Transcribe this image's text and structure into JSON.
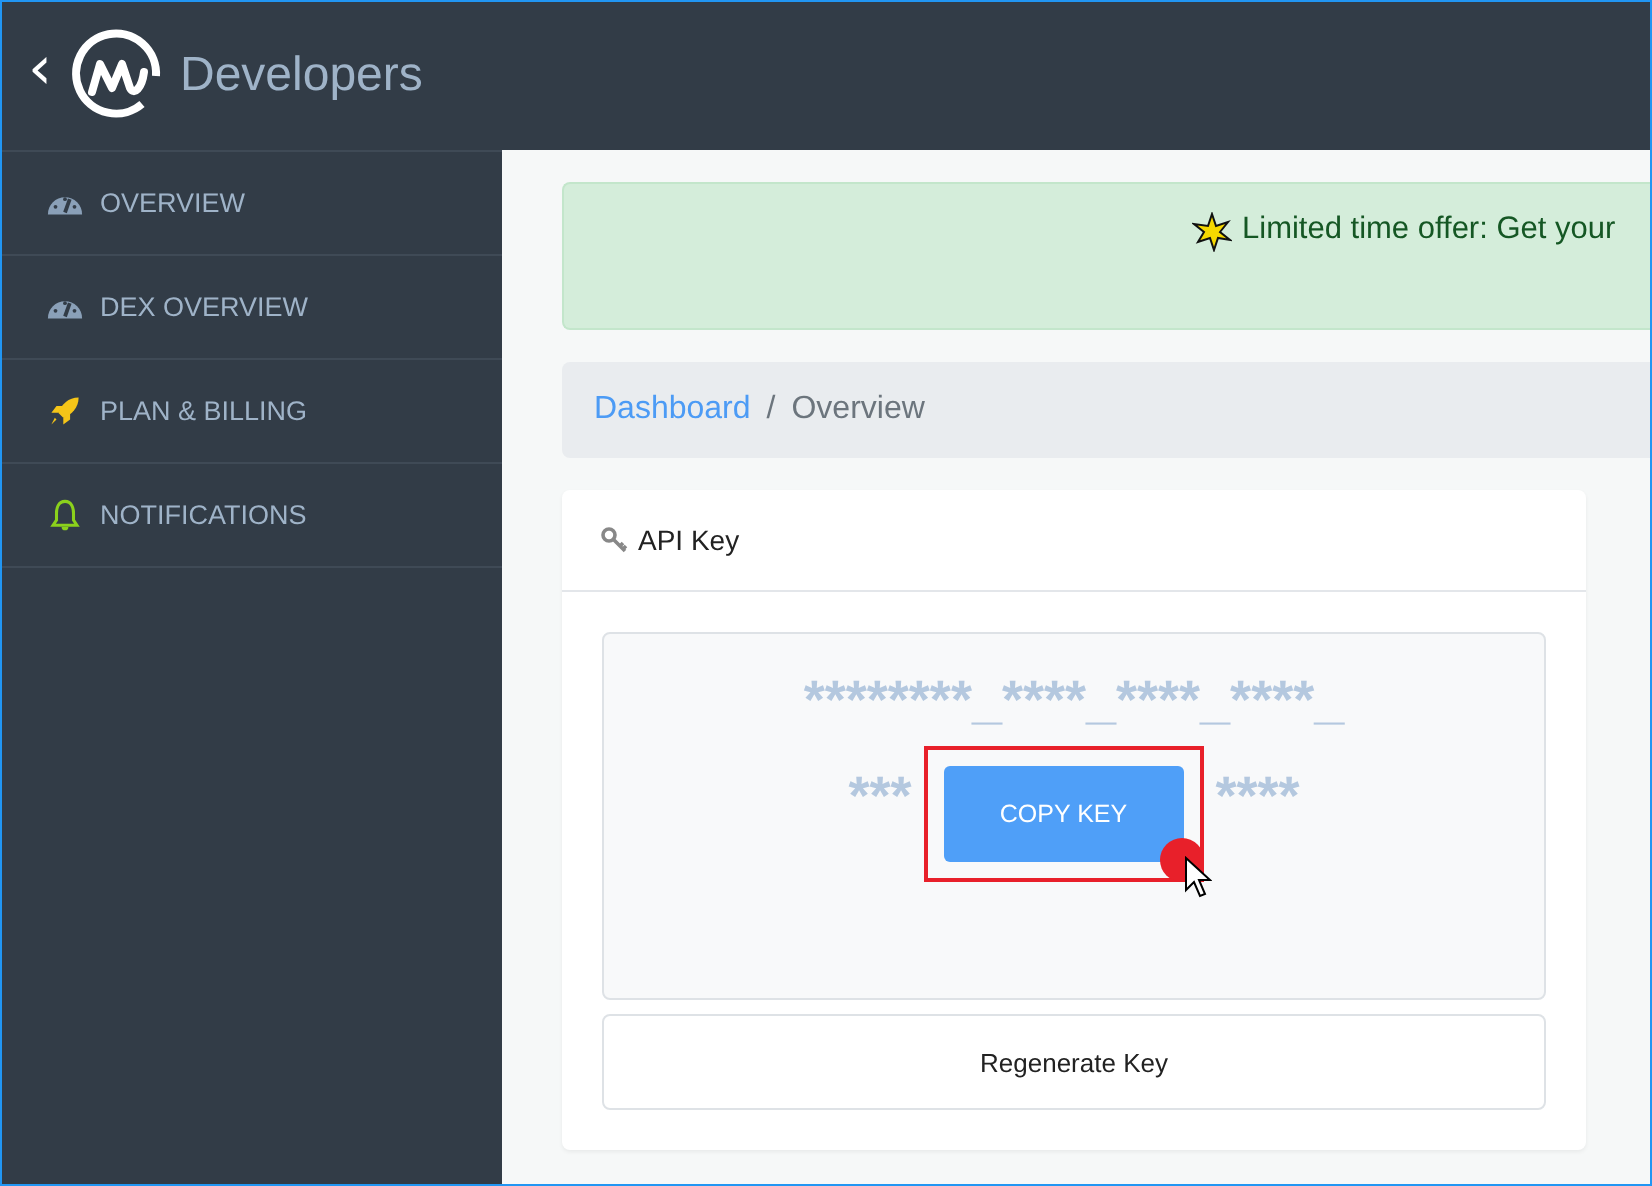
{
  "header": {
    "back": "‹",
    "title": "Developers"
  },
  "sidebar": {
    "items": [
      {
        "label": "OVERVIEW",
        "kind": "gauge",
        "selected": false
      },
      {
        "label": "DEX OVERVIEW",
        "kind": "gauge",
        "selected": false
      },
      {
        "label": "PLAN & BILLING",
        "kind": "rocket",
        "selected": false
      },
      {
        "label": "NOTIFICATIONS",
        "kind": "bell",
        "selected": false
      }
    ]
  },
  "banner": {
    "text": "Limited time offer: Get your"
  },
  "breadcrumb": [
    {
      "label": "Dashboard",
      "kind": "link"
    },
    {
      "label": "/",
      "kind": "separator"
    },
    {
      "label": "Overview",
      "kind": "current"
    }
  ],
  "api_card": {
    "title": "API Key",
    "key_line": "********_****_****_****_",
    "key_left": "***",
    "key_right": "****",
    "copy_button": "COPY KEY",
    "regenerate_button": "Regenerate Key"
  }
}
